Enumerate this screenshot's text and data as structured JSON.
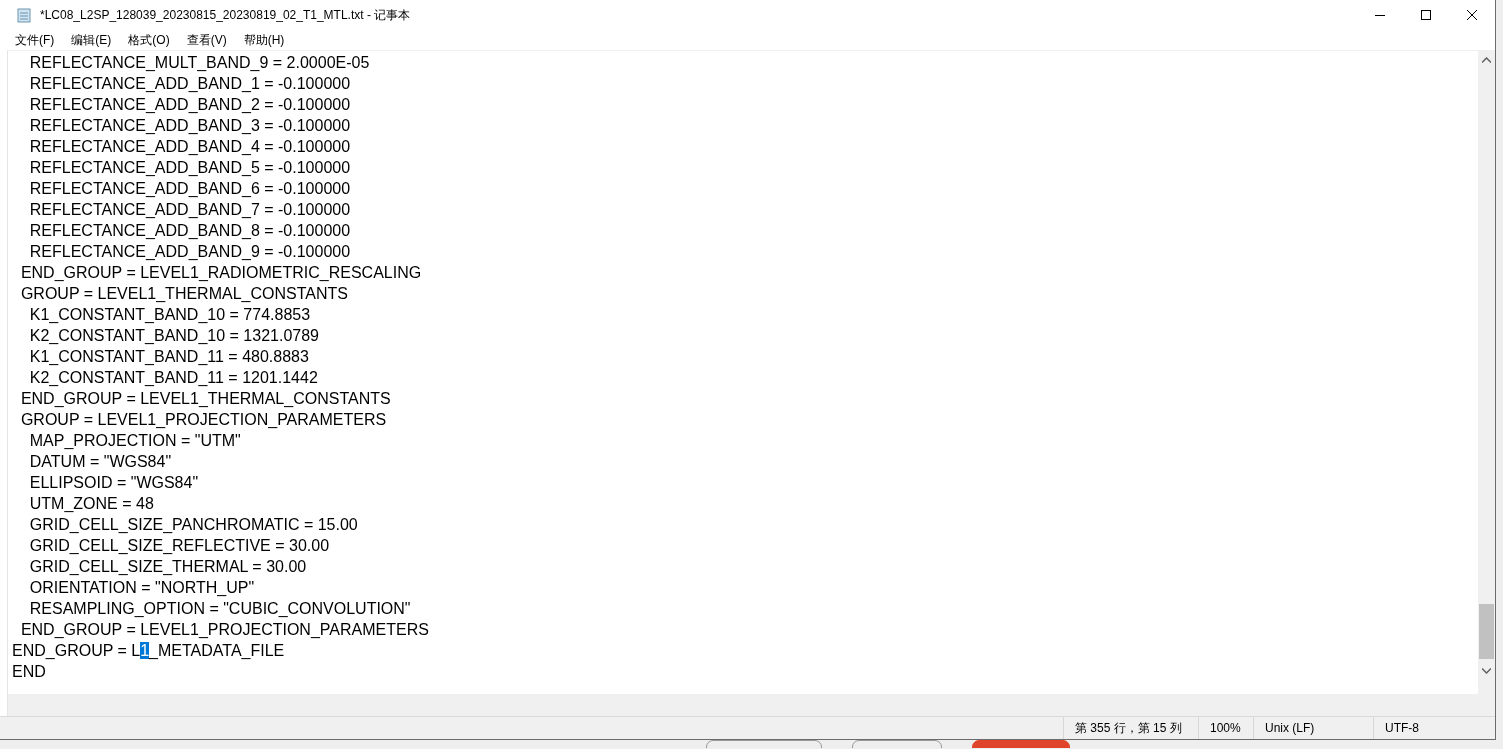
{
  "window": {
    "title": "*LC08_L2SP_128039_20230815_20230819_02_T1_MTL.txt - 记事本"
  },
  "menu": [
    {
      "label": "文件(F)"
    },
    {
      "label": "编辑(E)"
    },
    {
      "label": "格式(O)"
    },
    {
      "label": "查看(V)"
    },
    {
      "label": "帮助(H)"
    }
  ],
  "editor": {
    "lines": [
      "    REFLECTANCE_MULT_BAND_9 = 2.0000E-05",
      "    REFLECTANCE_ADD_BAND_1 = -0.100000",
      "    REFLECTANCE_ADD_BAND_2 = -0.100000",
      "    REFLECTANCE_ADD_BAND_3 = -0.100000",
      "    REFLECTANCE_ADD_BAND_4 = -0.100000",
      "    REFLECTANCE_ADD_BAND_5 = -0.100000",
      "    REFLECTANCE_ADD_BAND_6 = -0.100000",
      "    REFLECTANCE_ADD_BAND_7 = -0.100000",
      "    REFLECTANCE_ADD_BAND_8 = -0.100000",
      "    REFLECTANCE_ADD_BAND_9 = -0.100000",
      "  END_GROUP = LEVEL1_RADIOMETRIC_RESCALING",
      "  GROUP = LEVEL1_THERMAL_CONSTANTS",
      "    K1_CONSTANT_BAND_10 = 774.8853",
      "    K2_CONSTANT_BAND_10 = 1321.0789",
      "    K1_CONSTANT_BAND_11 = 480.8883",
      "    K2_CONSTANT_BAND_11 = 1201.1442",
      "  END_GROUP = LEVEL1_THERMAL_CONSTANTS",
      "  GROUP = LEVEL1_PROJECTION_PARAMETERS",
      "    MAP_PROJECTION = \"UTM\"",
      "    DATUM = \"WGS84\"",
      "    ELLIPSOID = \"WGS84\"",
      "    UTM_ZONE = 48",
      "    GRID_CELL_SIZE_PANCHROMATIC = 15.00",
      "    GRID_CELL_SIZE_REFLECTIVE = 30.00",
      "    GRID_CELL_SIZE_THERMAL = 30.00",
      "    ORIENTATION = \"NORTH_UP\"",
      "    RESAMPLING_OPTION = \"CUBIC_CONVOLUTION\"",
      "  END_GROUP = LEVEL1_PROJECTION_PARAMETERS",
      {
        "segments": [
          {
            "text": "END_GROUP = L",
            "selected": false
          },
          {
            "text": "1",
            "selected": true
          },
          {
            "text": "_METADATA_FILE",
            "selected": false
          }
        ]
      },
      "END"
    ]
  },
  "status_bar": {
    "position": "第 355 行，第 15 列",
    "zoom": "100%",
    "line_ending": "Unix (LF)",
    "encoding": "UTF-8"
  }
}
